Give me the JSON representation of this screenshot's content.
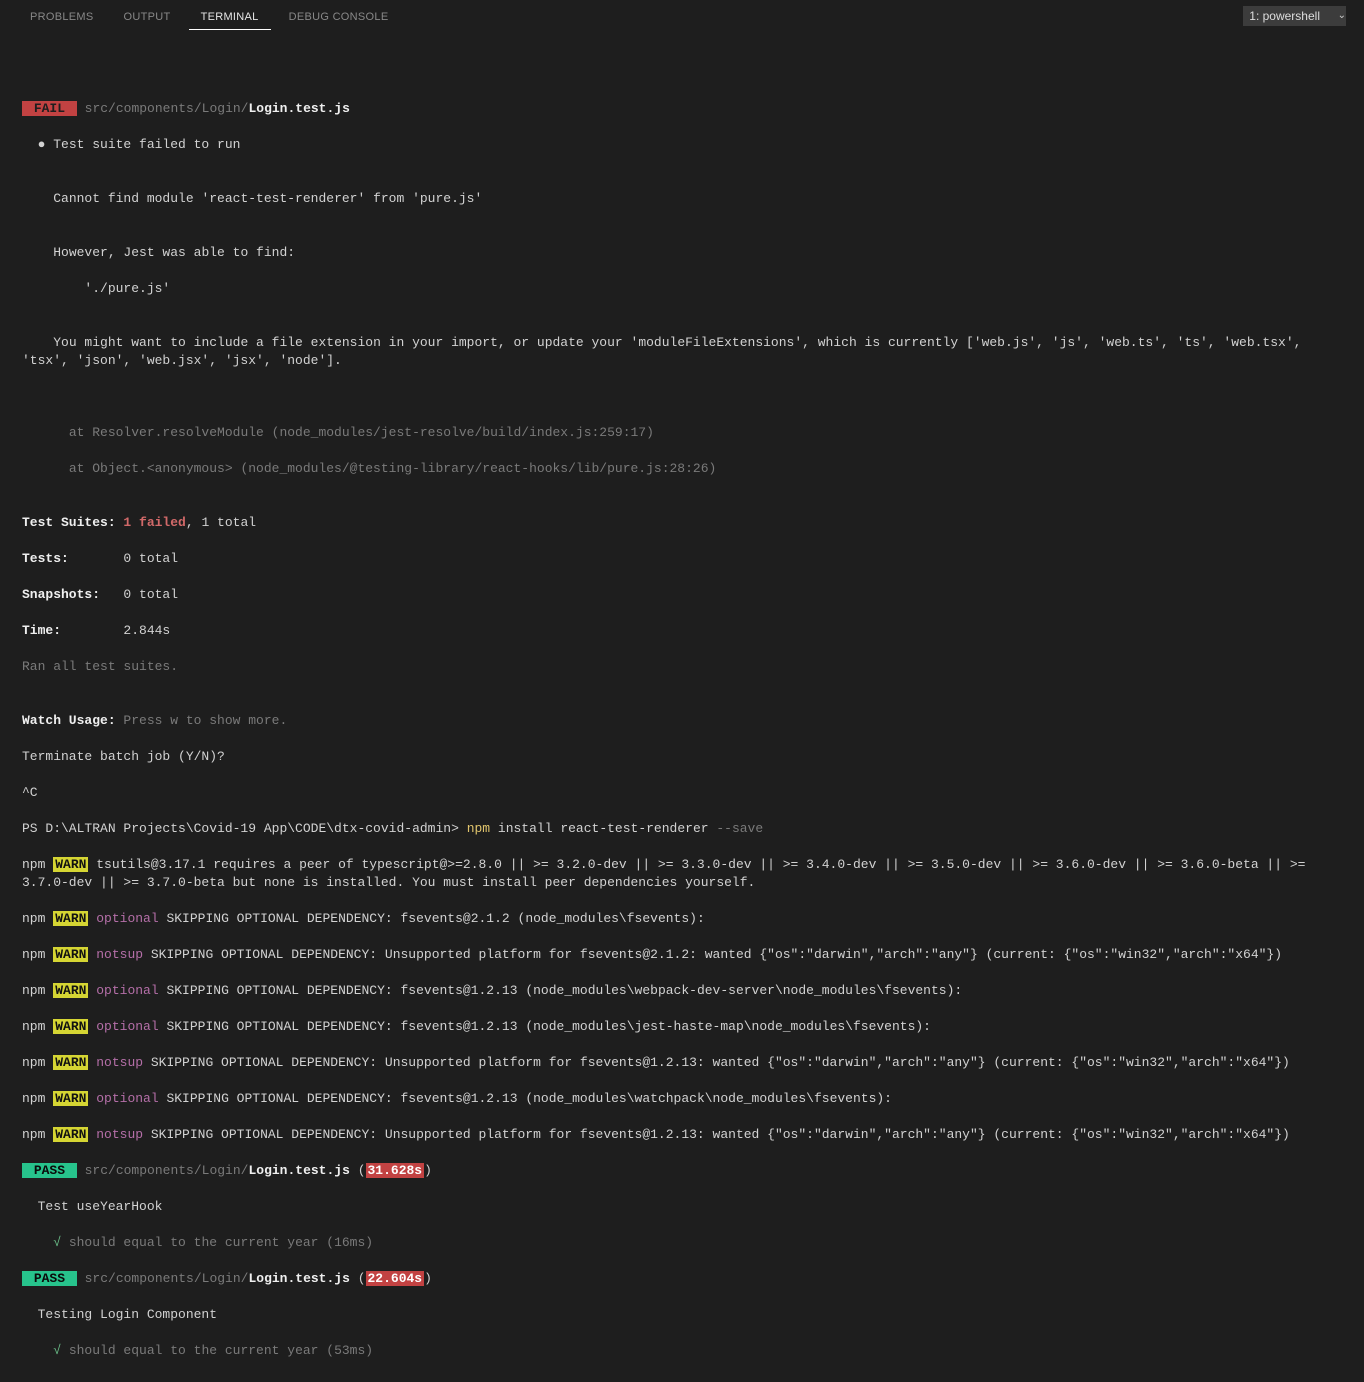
{
  "tabs": {
    "problems": "PROBLEMS",
    "output": "OUTPUT",
    "terminal": "TERMINAL",
    "debug": "DEBUG CONSOLE"
  },
  "shell": "1: powershell",
  "blank": "",
  "fail": {
    "badge": " FAIL ",
    "path_dim": "src/components/Login/",
    "file": "Login.test.js",
    "bullet": "  ● Test suite failed to run",
    "err1": "    Cannot find module 'react-test-renderer' from 'pure.js'",
    "err2": "    However, Jest was able to find:",
    "err3": "        './pure.js'",
    "err4": "    You might want to include a file extension in your import, or update your 'moduleFileExtensions', which is currently ['web.js', 'js', 'web.ts', 'ts', 'web.tsx', 'tsx', 'json', 'web.jsx', 'jsx', 'node'].",
    "stack1": "      at Resolver.resolveModule (node_modules/jest-resolve/build/index.js:259:17)",
    "stack2": "      at Object.<anonymous> (node_modules/@testing-library/react-hooks/lib/pure.js:28:26)"
  },
  "summary": {
    "suites_label": "Test Suites: ",
    "suites_fail": "1 failed",
    "suites_rest": ", 1 total",
    "tests_label": "Tests:       ",
    "tests_val": "0 total",
    "snaps_label": "Snapshots:   ",
    "snaps_val": "0 total",
    "time_label": "Time:        ",
    "time_val": "2.844s",
    "ran": "Ran all test suites."
  },
  "watch": {
    "label": "Watch Usage: ",
    "rest": "Press w to show more."
  },
  "terminate": "Terminate batch job (Y/N)?",
  "ctrl_c": "^C",
  "ps": {
    "prompt": "PS D:\\ALTRAN Projects\\Covid-19 App\\CODE\\dtx-covid-admin> ",
    "cmd_npm": "npm ",
    "cmd_rest": "install react-test-renderer ",
    "flag": "--save"
  },
  "npm": {
    "npm": "npm ",
    "warn": "WARN",
    "optional": " optional",
    "notsup": " notsup",
    "peer1": " tsutils@3.17.1 requires a peer of typescript@>=2.8.0 || >= 3.2.0-dev || >= 3.3.0-dev || >= 3.4.0-dev || >= 3.5.0-dev || >= 3.6.0-dev || >= 3.6.0-beta || >= 3.7.0-dev || >= 3.7.0-beta but none is installed. You must install peer dependencies yourself.",
    "l1": " SKIPPING OPTIONAL DEPENDENCY: fsevents@2.1.2 (node_modules\\fsevents):",
    "l2": " SKIPPING OPTIONAL DEPENDENCY: Unsupported platform for fsevents@2.1.2: wanted {\"os\":\"darwin\",\"arch\":\"any\"} (current: {\"os\":\"win32\",\"arch\":\"x64\"})",
    "l3": " SKIPPING OPTIONAL DEPENDENCY: fsevents@1.2.13 (node_modules\\webpack-dev-server\\node_modules\\fsevents):",
    "l4": " SKIPPING OPTIONAL DEPENDENCY: fsevents@1.2.13 (node_modules\\jest-haste-map\\node_modules\\fsevents):",
    "l5": " SKIPPING OPTIONAL DEPENDENCY: Unsupported platform for fsevents@1.2.13: wanted {\"os\":\"darwin\",\"arch\":\"any\"} (current: {\"os\":\"win32\",\"arch\":\"x64\"})",
    "l6": " SKIPPING OPTIONAL DEPENDENCY: fsevents@1.2.13 (node_modules\\watchpack\\node_modules\\fsevents):",
    "l7": " SKIPPING OPTIONAL DEPENDENCY: Unsupported platform for fsevents@1.2.13: wanted {\"os\":\"darwin\",\"arch\":\"any\"} (current: {\"os\":\"win32\",\"arch\":\"x64\"})"
  },
  "pass1": {
    "badge": " PASS ",
    "path_dim": " src/components/Login/",
    "file": "Login.test.js",
    "open": " (",
    "time": "31.628s",
    "close": ")",
    "desc": "  Test useYearHook",
    "check": "    √ ",
    "it": "should equal to the current year (16ms)"
  },
  "pass2": {
    "badge": " PASS ",
    "path_dim": " src/components/Login/",
    "file": "Login.test.js",
    "open": " (",
    "time": "22.604s",
    "close": ")",
    "desc": "  Testing Login Component",
    "check": "    √ ",
    "it": "should equal to the current year (53ms)"
  }
}
